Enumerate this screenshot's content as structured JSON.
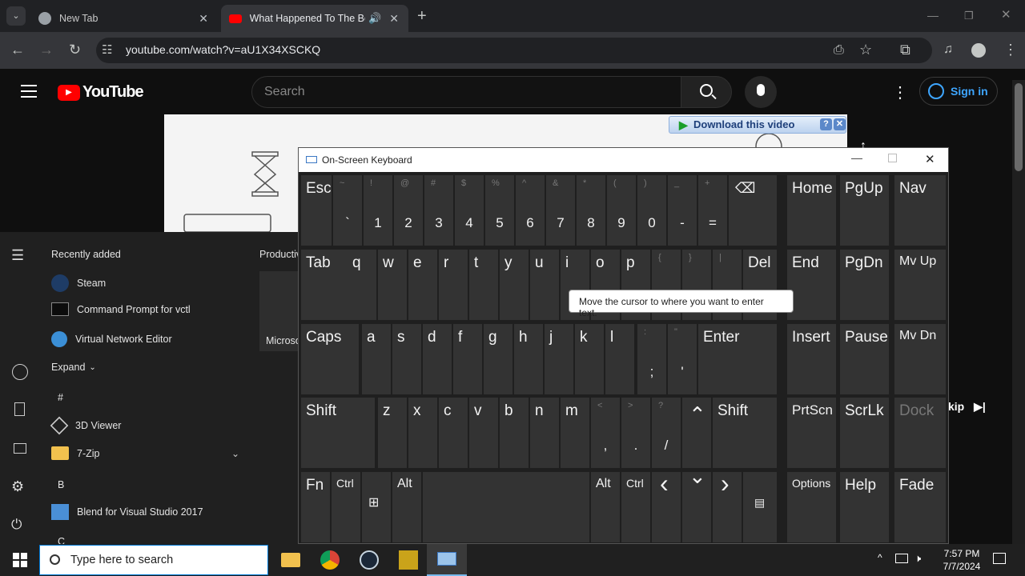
{
  "browser": {
    "tabs": [
      {
        "title": "New Tab",
        "active": false
      },
      {
        "title": "What Happened To The Boe",
        "active": true
      }
    ],
    "url": "youtube.com/watch?v=aU1X34XSCKQ"
  },
  "youtube": {
    "brand": "YouTube",
    "search_placeholder": "Search",
    "sign_in": "Sign in",
    "download_bar": "Download this video",
    "player_skip": "kip"
  },
  "start_menu": {
    "recently_added": "Recently added",
    "productive": "Productiv",
    "tile_label": "Microso",
    "recent": [
      "Steam",
      "Command Prompt for vctl",
      "Virtual Network Editor"
    ],
    "expand": "Expand",
    "hash": "#",
    "apps": [
      "3D Viewer",
      "7-Zip"
    ],
    "letter_b": "B",
    "app_b": "Blend for Visual Studio 2017",
    "letter_c": "C"
  },
  "osk": {
    "title": "On-Screen Keyboard",
    "tooltip": "Move the cursor to where you want to enter text.",
    "row1": [
      {
        "sh": "~",
        "lo": "`"
      },
      {
        "sh": "!",
        "lo": "1"
      },
      {
        "sh": "@",
        "lo": "2"
      },
      {
        "sh": "#",
        "lo": "3"
      },
      {
        "sh": "$",
        "lo": "4"
      },
      {
        "sh": "%",
        "lo": "5"
      },
      {
        "sh": "^",
        "lo": "6"
      },
      {
        "sh": "&",
        "lo": "7"
      },
      {
        "sh": "*",
        "lo": "8"
      },
      {
        "sh": "(",
        "lo": "9"
      },
      {
        "sh": ")",
        "lo": "0"
      },
      {
        "sh": "_",
        "lo": "-"
      },
      {
        "sh": "+",
        "lo": "="
      }
    ],
    "row2": [
      "q",
      "w",
      "e",
      "r",
      "t",
      "y",
      "u",
      "i",
      "o",
      "p"
    ],
    "row3": [
      "a",
      "s",
      "d",
      "f",
      "g",
      "h",
      "j",
      "k",
      "l"
    ],
    "row4": [
      "z",
      "x",
      "c",
      "v",
      "b",
      "n",
      "m"
    ],
    "keys": {
      "esc": "Esc",
      "tab": "Tab",
      "caps": "Caps",
      "shift": "Shift",
      "shift_r": "Shift",
      "fn": "Fn",
      "ctrl": "Ctrl",
      "alt": "Alt",
      "alt_r": "Alt",
      "ctrl_r": "Ctrl",
      "del": "Del",
      "enter": "Enter",
      "home": "Home",
      "pgup": "PgUp",
      "nav": "Nav",
      "end": "End",
      "pgdn": "PgDn",
      "mvup": "Mv Up",
      "insert": "Insert",
      "pause": "Pause",
      "mvdn": "Mv Dn",
      "prtscn": "PrtScn",
      "scrlk": "ScrLk",
      "dock": "Dock",
      "options": "Options",
      "help": "Help",
      "fade": "Fade",
      "br_open_sh": "{",
      "br_close_sh": "}",
      "pipe_sh": "|",
      "semi_sh": ":",
      "semi": ";",
      "quote_sh": "\"",
      "quote": "'",
      "lt": "<",
      "comma": ",",
      "gt": ">",
      "dot": ".",
      "q_sh": "?",
      "slash": "/"
    }
  },
  "taskbar": {
    "search_placeholder": "Type here to search",
    "time": "7:57 PM",
    "date": "7/7/2024"
  }
}
